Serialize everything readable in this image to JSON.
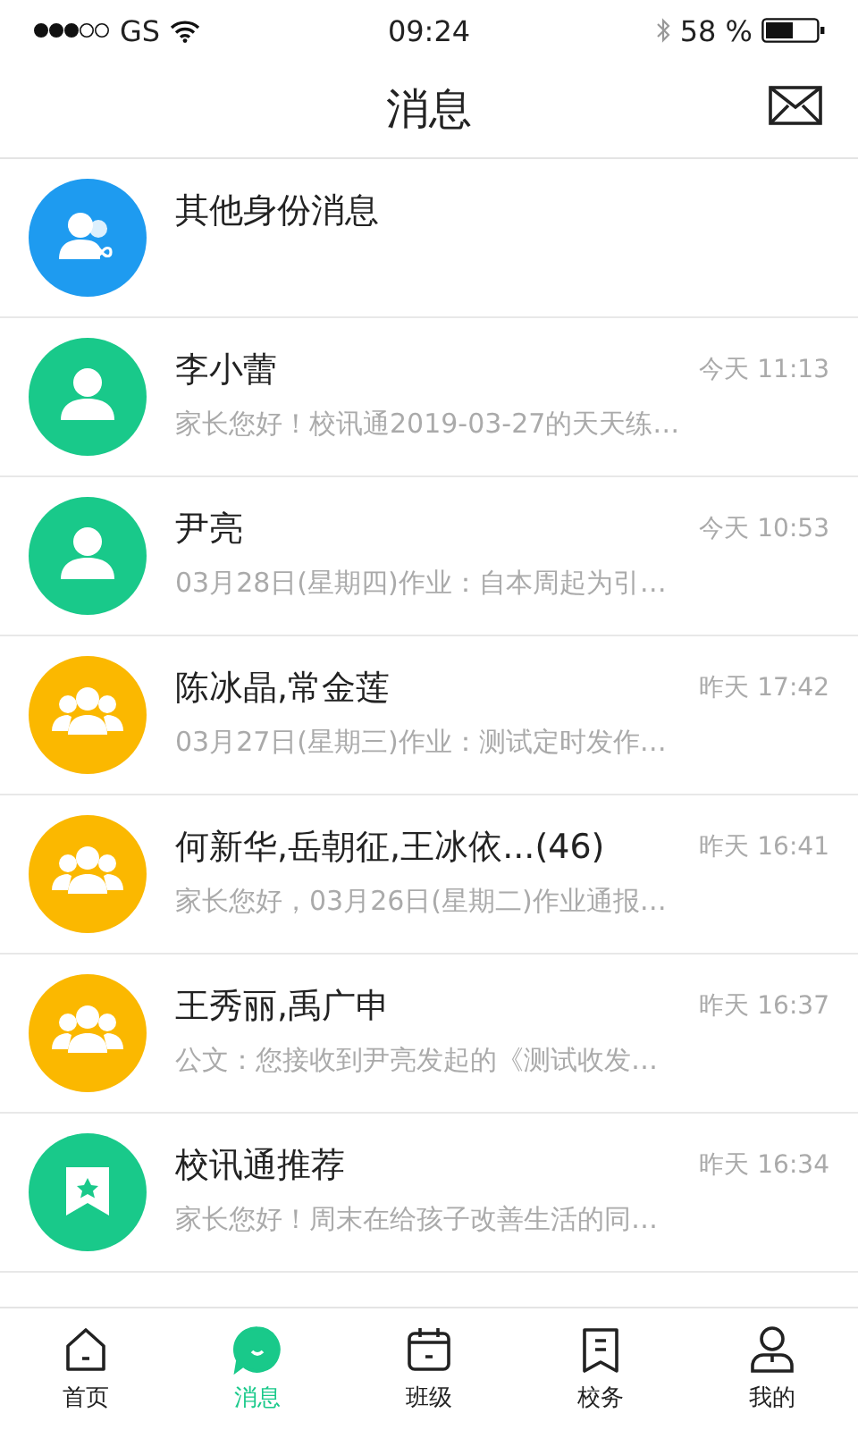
{
  "status_bar": {
    "carrier": "GS",
    "time": "09:24",
    "battery": "58 %"
  },
  "nav": {
    "title": "消息"
  },
  "messages": [
    {
      "kind": "identity",
      "name": "其他身份消息"
    },
    {
      "kind": "person",
      "name": "李小蕾",
      "time": "今天 11:13",
      "preview": "家长您好！校讯通2019-03-27的天天练…"
    },
    {
      "kind": "person",
      "name": "尹亮",
      "time": "今天 10:53",
      "preview": "03月28日(星期四)作业：自本周起为引…"
    },
    {
      "kind": "group",
      "name": "陈冰晶,常金莲",
      "time": "昨天 17:42",
      "preview": "03月27日(星期三)作业：测试定时发作…"
    },
    {
      "kind": "group",
      "name": "何新华,岳朝征,王冰依...(46)",
      "time": "昨天 16:41",
      "preview": "家长您好，03月26日(星期二)作业通报…"
    },
    {
      "kind": "group",
      "name": "王秀丽,禹广申",
      "time": "昨天 16:37",
      "preview": "公文：您接收到尹亮发起的《测试收发…"
    },
    {
      "kind": "recommend",
      "name": "校讯通推荐",
      "time": "昨天 16:34",
      "preview": "家长您好！周末在给孩子改善生活的同…"
    }
  ],
  "tabs": [
    {
      "kind": "home",
      "label": "首页",
      "selected": false
    },
    {
      "kind": "chat",
      "label": "消息",
      "selected": true
    },
    {
      "kind": "calendar",
      "label": "班级",
      "selected": false
    },
    {
      "kind": "doc",
      "label": "校务",
      "selected": false
    },
    {
      "kind": "user",
      "label": "我的",
      "selected": false
    }
  ]
}
